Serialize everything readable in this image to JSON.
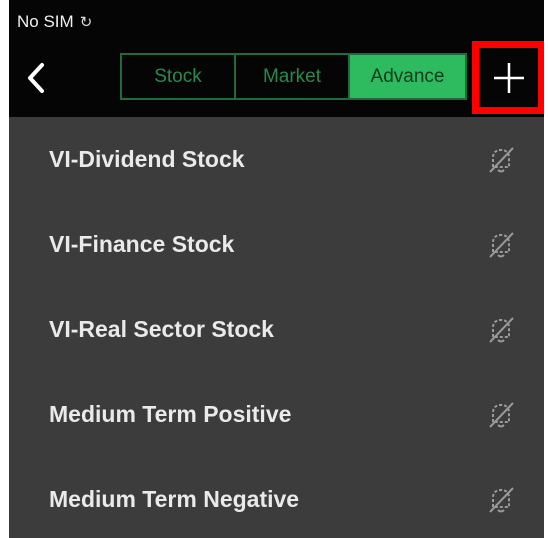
{
  "status_bar": {
    "carrier": "No SIM",
    "network_icon": "wifi-icon"
  },
  "nav": {
    "back_icon": "chevron-left-icon",
    "tabs": [
      {
        "label": "Stock",
        "active": false
      },
      {
        "label": "Market",
        "active": false
      },
      {
        "label": "Advance",
        "active": true
      }
    ],
    "add_icon": "plus-icon",
    "highlight_color": "#ff0000"
  },
  "colors": {
    "header_bg": "#050505",
    "list_bg": "#3c3c3c",
    "accent_green": "#2eba5f",
    "tab_border": "#1e6b3b"
  },
  "list": {
    "items": [
      {
        "label": "VI-Dividend Stock",
        "icon": "bell-off-icon"
      },
      {
        "label": "VI-Finance Stock",
        "icon": "bell-off-icon"
      },
      {
        "label": "VI-Real Sector Stock",
        "icon": "bell-off-icon"
      },
      {
        "label": "Medium Term Positive",
        "icon": "bell-off-icon"
      },
      {
        "label": "Medium Term Negative",
        "icon": "bell-off-icon"
      }
    ]
  }
}
